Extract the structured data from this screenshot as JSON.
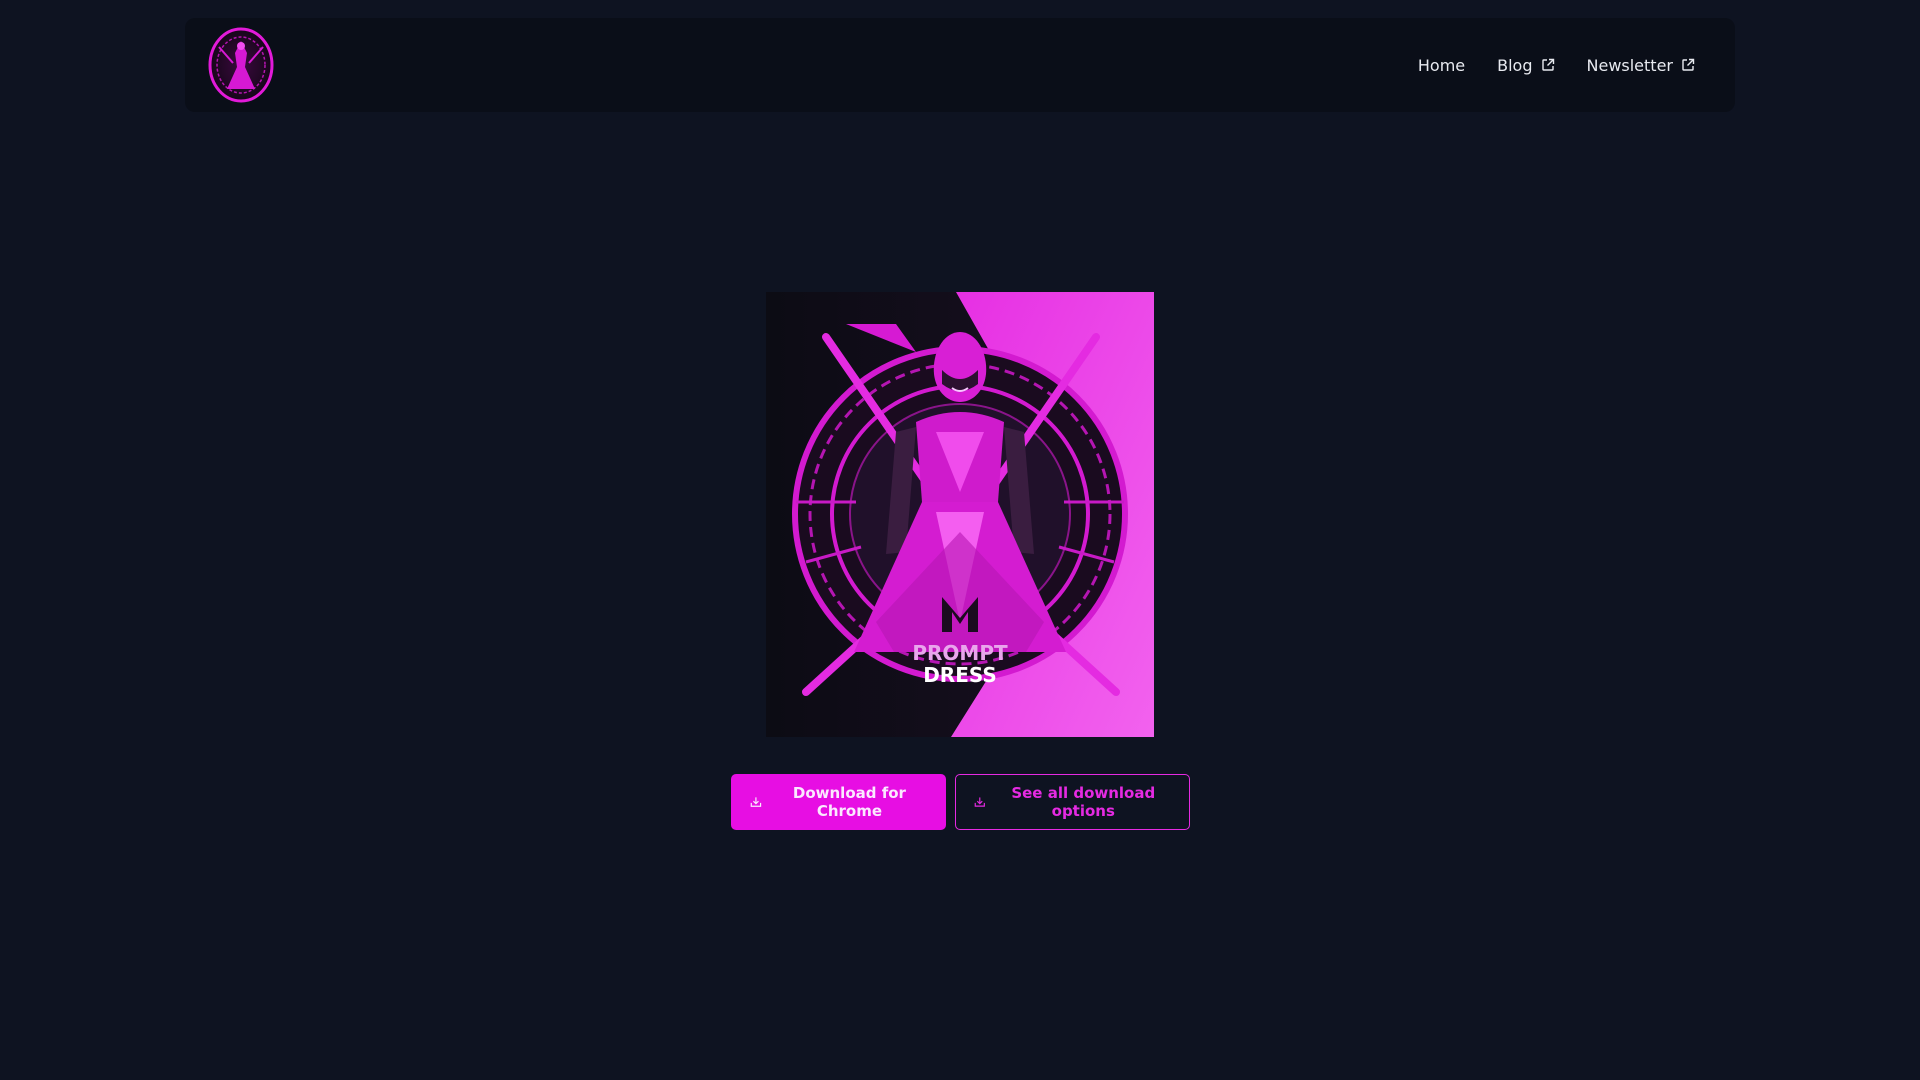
{
  "nav": {
    "logo_icon": "prompt-dress-logo-icon",
    "links": [
      {
        "label": "Home",
        "external": false
      },
      {
        "label": "Blog",
        "external": true
      },
      {
        "label": "Newsletter",
        "external": true
      }
    ]
  },
  "hero": {
    "brand_line1": "PROMPT",
    "brand_line2": "DRESS"
  },
  "actions": {
    "primary_label": "Download for Chrome",
    "secondary_label": "See all download options",
    "icon": "download-icon"
  },
  "colors": {
    "background": "#0e1321",
    "navbar": "#0a0e18",
    "accent": "#e70ee3"
  }
}
